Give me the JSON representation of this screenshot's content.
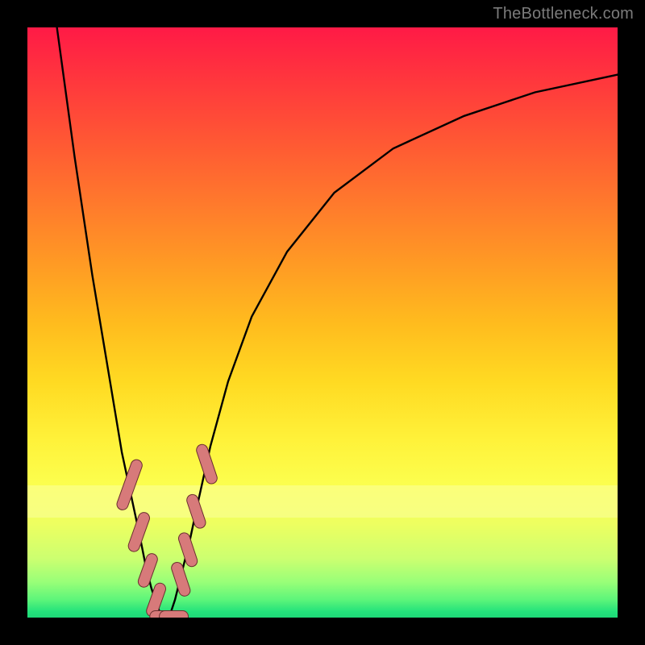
{
  "attribution": "TheBottleneck.com",
  "colors": {
    "frame": "#000000",
    "curve": "#000000",
    "marker_fill": "#d77a7a",
    "marker_stroke": "#6a2f2f"
  },
  "chart_data": {
    "type": "line",
    "title": "",
    "xlabel": "",
    "ylabel": "",
    "xlim": [
      0,
      100
    ],
    "ylim": [
      0,
      100
    ],
    "grid": false,
    "series": [
      {
        "name": "left-branch",
        "x": [
          5,
          8,
          11,
          14,
          16,
          17.5,
          19,
          20,
          21,
          22,
          22.8
        ],
        "y": [
          100,
          78,
          58,
          40,
          28,
          21,
          14,
          9,
          5,
          2,
          0
        ]
      },
      {
        "name": "right-branch",
        "x": [
          24,
          25,
          26,
          27.5,
          29,
          31,
          34,
          38,
          44,
          52,
          62,
          74,
          86,
          100
        ],
        "y": [
          0,
          3,
          7,
          13,
          20,
          29,
          40,
          51,
          62,
          72,
          79.5,
          85,
          89,
          92
        ]
      }
    ],
    "markers": [
      {
        "branch": "left",
        "x": 17.3,
        "y": 22.5,
        "len": 7
      },
      {
        "branch": "left",
        "x": 18.9,
        "y": 14.5,
        "len": 5
      },
      {
        "branch": "left",
        "x": 20.4,
        "y": 8.0,
        "len": 4
      },
      {
        "branch": "left",
        "x": 21.8,
        "y": 3.0,
        "len": 4
      },
      {
        "branch": "floor",
        "x": 23.2,
        "y": 0.2,
        "len": 3
      },
      {
        "branch": "floor",
        "x": 24.8,
        "y": 0.2,
        "len": 3
      },
      {
        "branch": "right",
        "x": 26.0,
        "y": 6.5,
        "len": 4
      },
      {
        "branch": "right",
        "x": 27.2,
        "y": 11.5,
        "len": 4
      },
      {
        "branch": "right",
        "x": 28.6,
        "y": 18.0,
        "len": 4
      },
      {
        "branch": "right",
        "x": 30.4,
        "y": 26.0,
        "len": 5
      }
    ]
  }
}
